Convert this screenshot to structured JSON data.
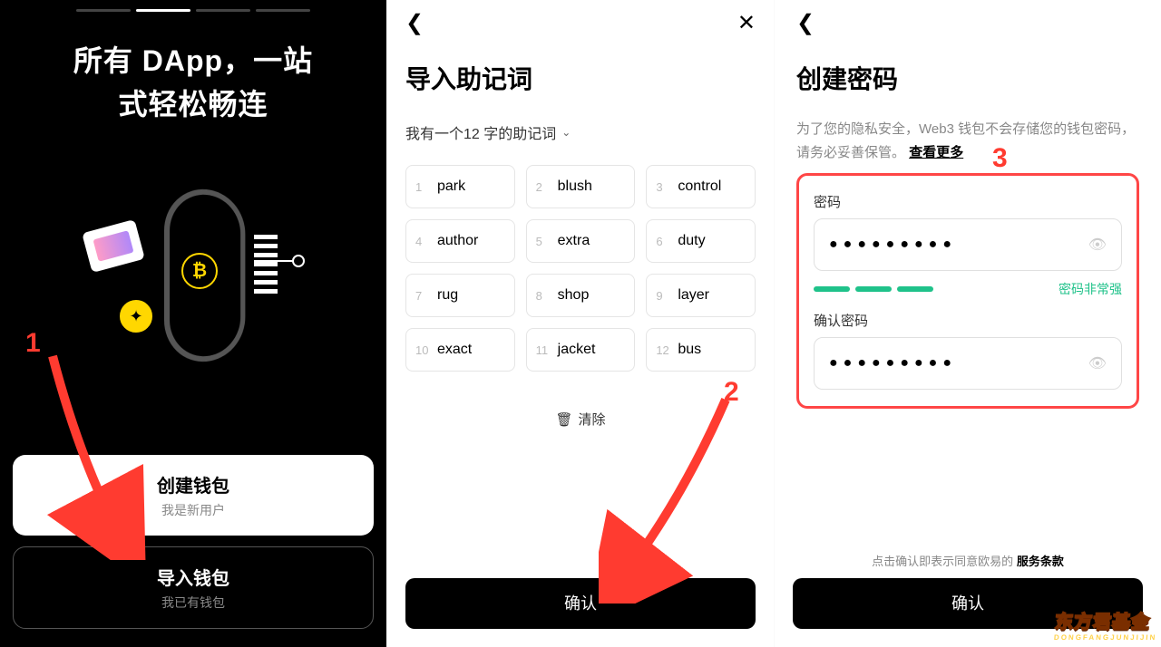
{
  "panel1": {
    "headline_l1": "所有 DApp，一站",
    "headline_l2": "式轻松畅连",
    "create": {
      "title": "创建钱包",
      "sub": "我是新用户"
    },
    "import": {
      "title": "导入钱包",
      "sub": "我已有钱包"
    }
  },
  "panel2": {
    "title": "导入助记词",
    "selector": "我有一个12 字的助记词",
    "words": [
      "park",
      "blush",
      "control",
      "author",
      "extra",
      "duty",
      "rug",
      "shop",
      "layer",
      "exact",
      "jacket",
      "bus"
    ],
    "clear": "清除",
    "confirm": "确认"
  },
  "panel3": {
    "title": "创建密码",
    "desc_a": "为了您的隐私安全，Web3 钱包不会存储您的钱包密码，请务必妥善保管。",
    "desc_link": "查看更多",
    "pw_label": "密码",
    "pw_value": "●●●●●●●●●",
    "strength": "密码非常强",
    "confirm_label": "确认密码",
    "confirm_value": "●●●●●●●●●",
    "agree_a": "点击确认即表示同意欧易的",
    "agree_b": "服务条款",
    "confirm_btn": "确认"
  },
  "anno": {
    "n1": "1",
    "n2": "2",
    "n3": "3"
  },
  "watermark": "东方君基金"
}
